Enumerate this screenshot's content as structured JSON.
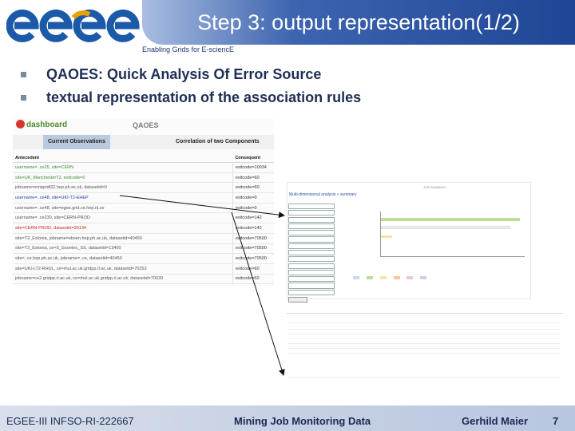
{
  "header": {
    "logo_text": "egee",
    "title": "Step 3: output representation(1/2)",
    "tagline": "Enabling Grids for E-sciencE"
  },
  "bullets": [
    "QAOES: Quick Analysis Of Error Source",
    "textual representation of the association rules"
  ],
  "dashboard": {
    "brand": "dashboard",
    "app_title": "QAOES",
    "tabs": [
      "Current Observations",
      "Correlation of two Components"
    ],
    "columns": [
      "Antecedent",
      "Consequent"
    ],
    "rows": [
      {
        "antecedent": "username=..ce25, site=CERN",
        "consequent": "exitcode=10034",
        "color": "green"
      },
      {
        "antecedent": "site=UK_ManchesterT2, exitcode=0",
        "consequent": "exitcode=60",
        "color": "green"
      },
      {
        "antecedent": "jobname=emtgridt32.hep.ph.ac.uk, datasetid=0",
        "consequent": "exitcode=60",
        "color": "gray"
      },
      {
        "antecedent": "username=..ce48, site=UKI-T2-EHEP",
        "consequent": "exitcode=0",
        "color": "blue"
      },
      {
        "antecedent": "username=..ce48, site=egee.grid.ce.hep.nl.ce",
        "consequent": "exitcode=0",
        "color": "gray"
      },
      {
        "antecedent": "username=..ce230, site=CERN-PROD",
        "consequent": "exitcode=142",
        "color": "gray"
      },
      {
        "antecedent": "site=CERN-PROD, datasetid=30134",
        "consequent": "exitcode=142",
        "color": "red"
      },
      {
        "antecedent": "site=T2_Estonia, jobname=ebsen.hep.ph.ac.uk, datasetid=40450",
        "consequent": "exitcode=70500",
        "color": "gray"
      },
      {
        "antecedent": "site=T2_Estonia, ce=3_Gsoetec_SS, datasetid=13400",
        "consequent": "exitcode=70500",
        "color": "gray"
      },
      {
        "antecedent": "site=..ce.hep.ph.ac.uk, jobname=..ce, datasetid=40450",
        "consequent": "exitcode=70500",
        "color": "gray"
      },
      {
        "antecedent": "site=UKI-LT2-RHUL, ce=rhul.ac.uk.gridpp.rl.ac.uk, datasetid=70253",
        "consequent": "exitcode=60",
        "color": "gray"
      },
      {
        "antecedent": "jobname=ce2.gridpp.rl.ac.uk, ce=rhul.ac.uk.gridpp.rl.ac.uk, datasetid=70030",
        "consequent": "exitcode=60",
        "color": "gray"
      }
    ]
  },
  "chart_panel": {
    "breadcrumb": "Multi-dimensional analysis » summary",
    "top_label": "JOB SUMMARY"
  },
  "footer": {
    "left": "EGEE-III INFSO-RI-222667",
    "middle": "Mining Job Monitoring Data",
    "author": "Gerhild Maier",
    "page": "7"
  },
  "colors": {
    "title_bar": "#1f4596",
    "logo_blue": "#1a5aa8",
    "footer_bg": "#c7d1e3",
    "bullet_text": "#1f2e55",
    "highlight_red": "#d2261e"
  }
}
